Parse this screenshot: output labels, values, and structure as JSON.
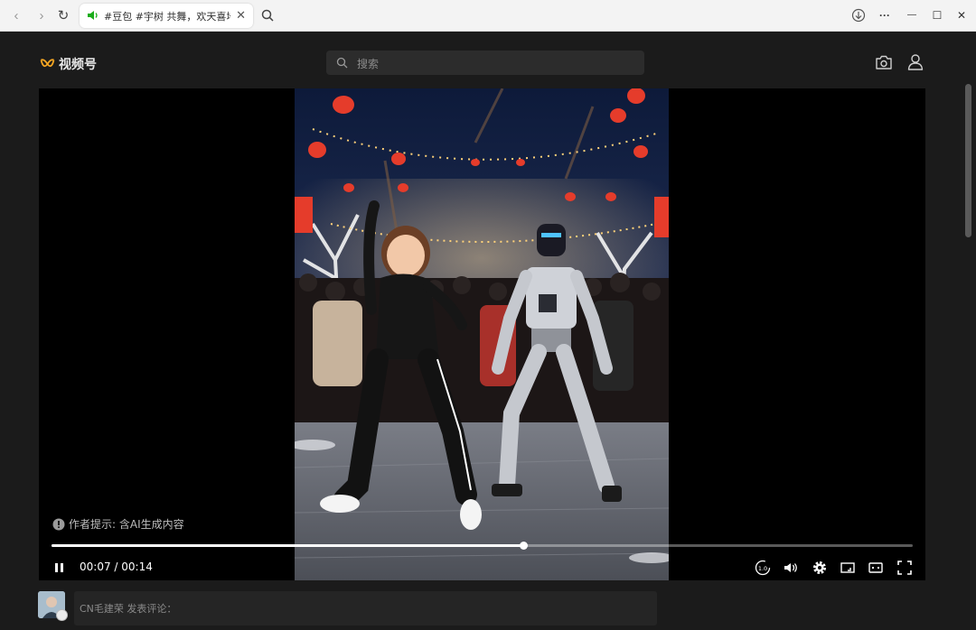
{
  "browser": {
    "tab_title": "#豆包 #宇树 共舞，欢天喜地",
    "close_symbol": "✕",
    "back_symbol": "‹",
    "forward_symbol": "›",
    "reload_symbol": "↻",
    "menu_symbol": "···",
    "minimize_symbol": "—",
    "maximize_symbol": "☐",
    "window_close_symbol": "✕"
  },
  "header": {
    "logo_text": "视频号",
    "search_placeholder": "搜索"
  },
  "player": {
    "ai_notice": "作者提示: 含AI生成内容",
    "time_current": "00:07",
    "time_separator": " / ",
    "time_total": "00:14",
    "progress_fraction": 0.548,
    "speed_label": "1.0"
  },
  "comment": {
    "placeholder": "CN毛建荣 发表评论："
  },
  "colors": {
    "accent": "#f5a623",
    "background": "#1b1b1b",
    "player_bg": "#000000"
  },
  "icons": [
    "back-icon",
    "forward-icon",
    "reload-icon",
    "sound-icon",
    "close-icon",
    "search-icon",
    "download-icon",
    "more-icon",
    "minimize-icon",
    "maximize-icon",
    "camera-icon",
    "user-icon",
    "pause-icon",
    "speed-icon",
    "volume-icon",
    "settings-icon",
    "cast-icon",
    "subtitle-icon",
    "fullscreen-icon",
    "warning-icon"
  ]
}
